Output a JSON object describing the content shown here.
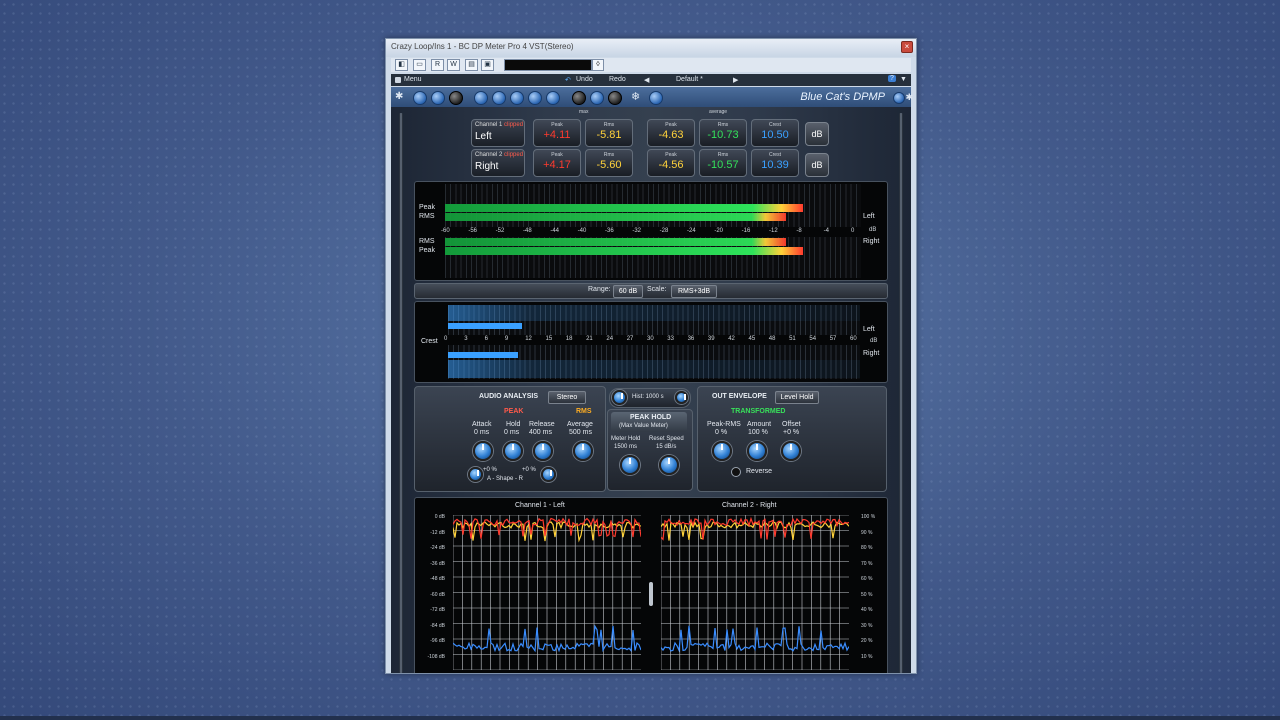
{
  "window": {
    "title": "Crazy Loop/Ins 1 - BC DP Meter Pro 4 VST(Stereo)",
    "close_glyph": "×"
  },
  "host": {
    "toolbar_buttons": [
      "◧",
      "▭",
      "R",
      "W",
      "▤",
      "▣"
    ],
    "dropdown_glyph": "◊",
    "menu": "Menu",
    "undo": "Undo",
    "redo": "Redo",
    "preset": "Default *",
    "prev": "◀",
    "next": "▶",
    "help": "?",
    "collapse": "▼"
  },
  "plugin": {
    "brand": "Blue Cat's DPMP",
    "group_max": "max",
    "group_average": "average",
    "channels": [
      {
        "tag": "Channel 1",
        "clipped": "clipped",
        "name": "Left",
        "max_peak": "+4.11",
        "max_rms": "-5.81",
        "avg_peak": "-4.63",
        "avg_rms": "-10.73",
        "crest": "10.50"
      },
      {
        "tag": "Channel 2",
        "clipped": "clipped",
        "name": "Right",
        "max_peak": "+4.17",
        "max_rms": "-5.60",
        "avg_peak": "-4.56",
        "avg_rms": "-10.57",
        "crest": "10.39"
      }
    ],
    "labels": {
      "peak": "Peak",
      "rms": "Rms",
      "crest": "Crest",
      "db": "dB"
    },
    "level_meter": {
      "peak_label": "Peak",
      "rms_label": "RMS",
      "left": "Left",
      "right": "Right",
      "scale": [
        "-60",
        "-56",
        "-52",
        "-48",
        "-44",
        "-40",
        "-36",
        "-32",
        "-28",
        "-24",
        "-20",
        "-16",
        "-12",
        "-8",
        "-4",
        "0"
      ],
      "unit": "dB",
      "left_peak_fraction": 0.86,
      "left_rms_fraction": 0.82,
      "right_peak_fraction": 0.86,
      "right_rms_fraction": 0.82
    },
    "range_row": {
      "range_label": "Range:",
      "range_value": "60 dB",
      "scale_label": "Scale:",
      "scale_value": "RMS+3dB"
    },
    "crest_meter": {
      "label": "Crest",
      "unit": "dB",
      "left": "Left",
      "right": "Right",
      "scale": [
        "0",
        "3",
        "6",
        "9",
        "12",
        "15",
        "18",
        "21",
        "24",
        "27",
        "30",
        "33",
        "36",
        "39",
        "42",
        "45",
        "48",
        "51",
        "54",
        "57",
        "60"
      ],
      "left_fraction": 0.18,
      "right_fraction": 0.17
    },
    "audio_analysis": {
      "title": "AUDIO ANALYSIS",
      "mode": "Stereo",
      "peak_title": "PEAK",
      "rms_title": "RMS",
      "attack_label": "Attack",
      "attack_value": "0 ms",
      "hold_label": "Hold",
      "hold_value": "0 ms",
      "release_label": "Release",
      "release_value": "400 ms",
      "average_label": "Average",
      "average_value": "500 ms",
      "shape_left": "+0 %",
      "shape_right": "+0 %",
      "shape_label": "A - Shape - R"
    },
    "peak_hold": {
      "hist": "Hist: 1000 s",
      "title": "PEAK HOLD",
      "subtitle": "(Max Value Meter)",
      "meter_hold_label": "Meter Hold",
      "meter_hold_value": "1500 ms",
      "reset_speed_label": "Reset Speed",
      "reset_speed_value": "15 dB/s"
    },
    "out_envelope": {
      "title": "OUT ENVELOPE",
      "mode": "Level Hold",
      "transformed": "TRANSFORMED",
      "peak_rms_label": "Peak-RMS",
      "peak_rms_value": "0 %",
      "amount_label": "Amount",
      "amount_value": "100 %",
      "offset_label": "Offset",
      "offset_value": "+0 %",
      "reverse_label": "Reverse"
    },
    "history": {
      "ch1_title": "Channel 1 - Left",
      "ch2_title": "Channel 2 - Right",
      "db_axis": [
        "0 dB",
        "-12 dB",
        "-24 dB",
        "-36 dB",
        "-48 dB",
        "-60 dB",
        "-72 dB",
        "-84 dB",
        "-96 dB",
        "-108 dB"
      ],
      "pct_axis": [
        "100 %",
        "90 %",
        "80 %",
        "70 %",
        "60 %",
        "50 %",
        "40 %",
        "30 %",
        "20 %",
        "10 %"
      ]
    }
  },
  "colors": {
    "accent": "#2f7fd3",
    "peak_red": "#ff3a2e",
    "rms_yellow": "#ffd23a",
    "crest_blue": "#3aa0ff",
    "green": "#33e05a"
  }
}
